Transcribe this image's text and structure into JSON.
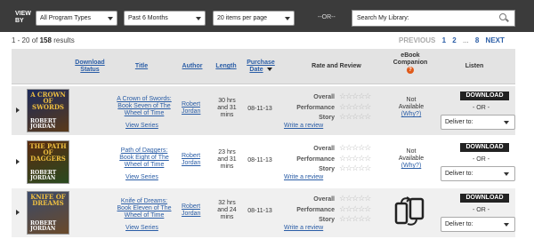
{
  "topbar": {
    "view_by": "VIEW BY",
    "program_type": "All Program Types",
    "period": "Past 6 Months",
    "per_page": "20 items per page",
    "or": "--OR--",
    "search_placeholder": "Search My Library:"
  },
  "results": {
    "prefix": "1 - 20",
    "of": "of",
    "total": "158",
    "suffix": "results"
  },
  "pager": {
    "prev": "PREVIOUS",
    "pages": [
      "1",
      "2"
    ],
    "ellipsis": "...",
    "last": "8",
    "next": "NEXT"
  },
  "columns": {
    "download_status": "Download Status",
    "title": "Title",
    "author": "Author",
    "length": "Length",
    "purchase_date": "Purchase Date",
    "rate_review": "Rate and Review",
    "ebook_companion": "eBook Companion",
    "ebook_help": "?",
    "listen": "Listen"
  },
  "rating_labels": [
    "Overall",
    "Performance",
    "Story"
  ],
  "stars": "☆☆☆☆☆",
  "books": [
    {
      "cover_title": "A CROWN OF SWORDS",
      "cover_author": "ROBERT JORDAN",
      "cover_colors": [
        "#1c2a5a",
        "#5a3a1a"
      ],
      "title": "A Crown of Swords: Book Seven of The Wheel of Time",
      "view_series": "View Series",
      "author": "Robert Jordan",
      "length": "30 hrs and 31 mins",
      "date": "08-11-13",
      "write_review": "Write a review",
      "ebook": "Not Available",
      "ebook_why": "(Why?)",
      "ebook_icon": false,
      "download": "DOWNLOAD",
      "or": "- OR -",
      "deliver": "Deliver to:"
    },
    {
      "cover_title": "THE PATH OF DAGGERS",
      "cover_author": "ROBERT JORDAN",
      "cover_colors": [
        "#5a2a10",
        "#2a4a20"
      ],
      "title": "Path of Daggers: Book Eight of The Wheel of Time",
      "view_series": "View Series",
      "author": "Robert Jordan",
      "length": "23 hrs and 31 mins",
      "date": "08-11-13",
      "write_review": "Write a review",
      "ebook": "Not Available",
      "ebook_why": "(Why?)",
      "ebook_icon": false,
      "download": "DOWNLOAD",
      "or": "- OR -",
      "deliver": "Deliver to:"
    },
    {
      "cover_title": "KNIFE OF DREAMS",
      "cover_author": "ROBERT JORDAN",
      "cover_colors": [
        "#3a4a6a",
        "#6a4a2a"
      ],
      "title": "Knife of Dreams: Book Eleven of The Wheel of Time",
      "view_series": "View Series",
      "author": "Robert Jordan",
      "length": "32 hrs and 24 mins",
      "date": "08-11-13",
      "write_review": "Write a review",
      "ebook": "",
      "ebook_why": "",
      "ebook_icon": true,
      "download": "DOWNLOAD",
      "or": "- OR -",
      "deliver": "Deliver to:"
    }
  ]
}
